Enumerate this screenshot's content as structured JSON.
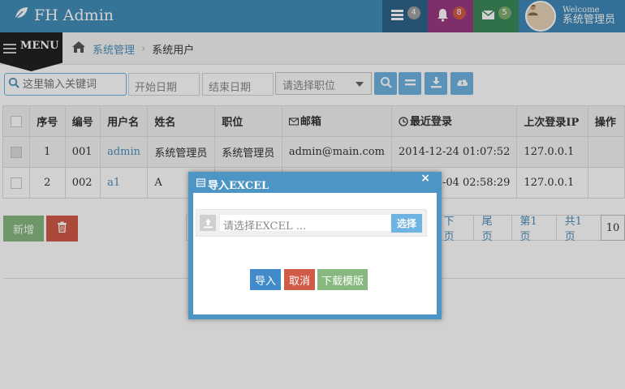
{
  "colors": {
    "primary": "#438eb9",
    "success": "#87b87f",
    "danger": "#d15b47",
    "info": "#6fb3e0"
  },
  "navbar": {
    "brand": "FH Admin",
    "tasks_count": "4",
    "alerts_count": "8",
    "messages_count": "5",
    "user_welcome": "Welcome",
    "user_name": "系统管理员"
  },
  "sidebar_toggle": {
    "label": "MENU"
  },
  "breadcrumb": {
    "parent": "系统管理",
    "current": "系统用户"
  },
  "filters": {
    "keyword_placeholder": "这里输入关键词",
    "start_date_placeholder": "开始日期",
    "end_date_placeholder": "结束日期",
    "role_select": "请选择职位"
  },
  "table": {
    "headers": {
      "index": "序号",
      "number": "编号",
      "username": "用户名",
      "name": "姓名",
      "role": "职位",
      "email": "邮箱",
      "last_login": "最近登录",
      "last_ip": "上次登录IP",
      "actions": "操作"
    },
    "rows": [
      {
        "index": "1",
        "number": "001",
        "username": "admin",
        "name": "系统管理员",
        "role": "系统管理员",
        "email": "admin@main.com",
        "last_login": "2014-12-24 01:07:52",
        "last_ip": "127.0.0.1"
      },
      {
        "index": "2",
        "number": "002",
        "username": "a1",
        "name": "A",
        "role": "",
        "email": "",
        "last_login": "11-04 02:58:29",
        "last_ip": "127.0.0.1"
      }
    ]
  },
  "actions": {
    "add_label": "新增"
  },
  "pagination": {
    "next": "下页",
    "last": "尾页",
    "current_page": "第1页",
    "total_pages": "共1页",
    "page_size": "10"
  },
  "dialog": {
    "title": "导入EXCEL",
    "close": "×",
    "file_placeholder": "请选择EXCEL ...",
    "choose_label": "选择",
    "import_label": "导入",
    "cancel_label": "取消",
    "template_label": "下载模版"
  }
}
